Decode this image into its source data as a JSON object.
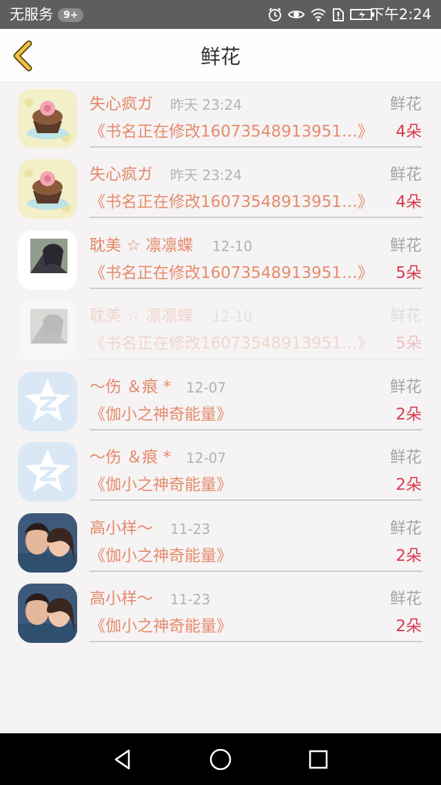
{
  "status_bar": {
    "carrier": "无服务",
    "badge": "9+",
    "time": "下午2:24",
    "icons": [
      "alarm-icon",
      "eye-icon",
      "wifi-icon",
      "sim-alert-icon",
      "battery-charging-icon"
    ]
  },
  "nav": {
    "title": "鲜花",
    "back_icon": "chevron-left-icon"
  },
  "items": [
    {
      "name": "失心疯ガ",
      "date": "昨天 23:24",
      "kind": "鲜花",
      "book": "《书名正在修改16073548913951…》",
      "count": "4朵",
      "avatar": "cupcake"
    },
    {
      "name": "失心疯ガ",
      "date": "昨天 23:24",
      "kind": "鲜花",
      "book": "《书名正在修改16073548913951…》",
      "count": "4朵",
      "avatar": "cupcake"
    },
    {
      "name": "耽美 ☆ 凛凛蝶",
      "date": "12-10",
      "kind": "鲜花",
      "book": "《书名正在修改16073548913951…》",
      "count": "5朵",
      "avatar": "photo-girl"
    },
    {
      "name": "耽美 ☆ 凛凛蝶",
      "date": "12-10",
      "kind": "鲜花",
      "book": "《书名正在修改16073548913951…》",
      "count": "5朵",
      "avatar": "photo-girl"
    },
    {
      "name": "～伤 ＆痕 *",
      "date": "12-07",
      "kind": "鲜花",
      "book": "《伽小之神奇能量》",
      "count": "2朵",
      "avatar": "qzone-star"
    },
    {
      "name": "～伤 ＆痕 *",
      "date": "12-07",
      "kind": "鲜花",
      "book": "《伽小之神奇能量》",
      "count": "2朵",
      "avatar": "qzone-star"
    },
    {
      "name": "高小样～",
      "date": "11-23",
      "kind": "鲜花",
      "book": "《伽小之神奇能量》",
      "count": "2朵",
      "avatar": "photo-couple"
    },
    {
      "name": "高小样～",
      "date": "11-23",
      "kind": "鲜花",
      "book": "《伽小之神奇能量》",
      "count": "2朵",
      "avatar": "photo-couple"
    }
  ],
  "system_nav": {
    "icons": [
      "back-triangle-icon",
      "home-circle-icon",
      "recents-square-icon"
    ]
  }
}
